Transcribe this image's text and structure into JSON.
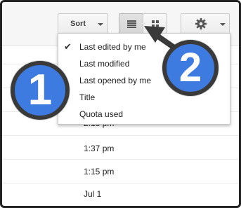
{
  "toolbar": {
    "sort_label": "Sort",
    "list_view_icon": "list-view-icon",
    "grid_view_icon": "grid-view-icon",
    "settings_icon": "gear-icon"
  },
  "sort_menu": {
    "selected": "Last edited by me",
    "items": [
      {
        "label": "Last edited by me",
        "checked": true
      },
      {
        "label": "Last modified",
        "checked": false
      },
      {
        "label": "Last opened by me",
        "checked": false
      },
      {
        "label": "Title",
        "checked": false
      },
      {
        "label": "Quota used",
        "checked": false
      }
    ]
  },
  "file_list": {
    "times": [
      "2:13 pm",
      "1:37 pm",
      "1:15 pm",
      "Jul 1"
    ]
  },
  "callouts": [
    {
      "number": "1"
    },
    {
      "number": "2"
    }
  ],
  "colors": {
    "callout_fill": "#3d7be0",
    "callout_border": "#3a3a3a",
    "arrow": "#3a3a3a"
  }
}
